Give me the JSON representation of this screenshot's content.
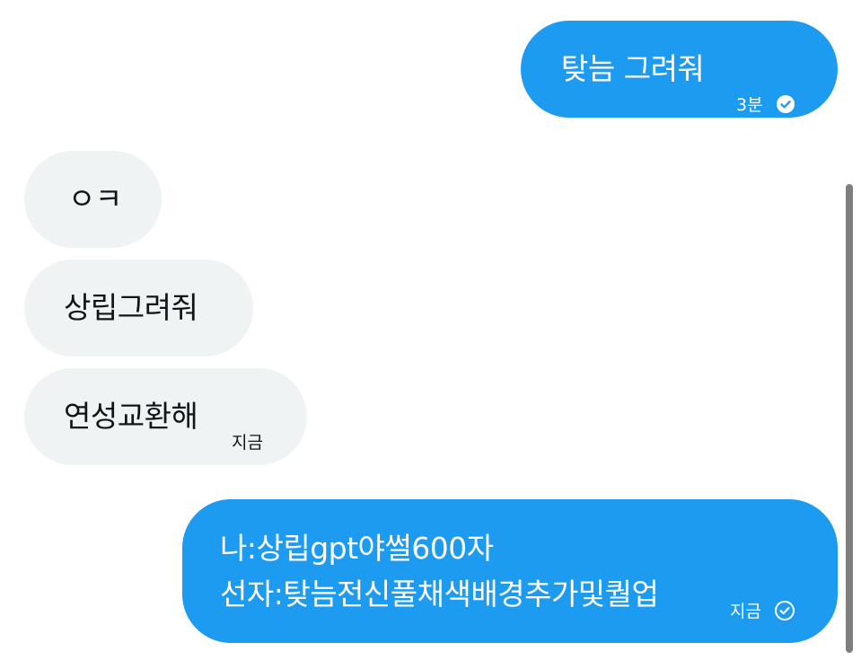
{
  "conversation": {
    "messages": [
      {
        "direction": "outgoing",
        "text": "탖늠 그려줘",
        "time": "3분",
        "status": "read",
        "status_icon": "check-filled-icon"
      },
      {
        "direction": "incoming",
        "text": "ㅇㅋ"
      },
      {
        "direction": "incoming",
        "text": "상립그려줘"
      },
      {
        "direction": "incoming",
        "text": "연성교환해",
        "time": "지금"
      },
      {
        "direction": "outgoing",
        "lines": [
          "나:상립gpt야썰600자",
          "선자:탖늠전신풀채색배경추가및퀄업"
        ],
        "time": "지금",
        "status": "sent",
        "status_icon": "check-outline-icon"
      }
    ]
  },
  "colors": {
    "outgoing_bubble": "#1d9bf0",
    "incoming_bubble": "#eff3f4",
    "incoming_text": "#0f1419",
    "scrollbar": "#7f7f7f"
  }
}
